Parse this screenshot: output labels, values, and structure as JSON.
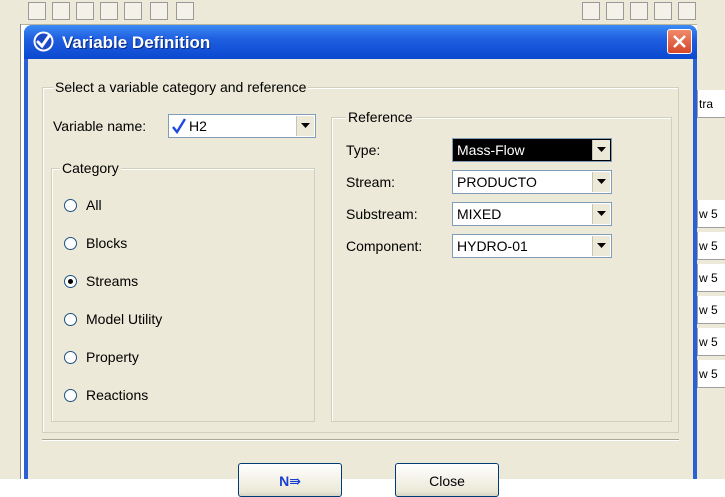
{
  "window": {
    "title": "Variable Definition"
  },
  "section_select": {
    "legend": "Select a variable category and reference"
  },
  "variable": {
    "label": "Variable name:",
    "value": "H2"
  },
  "category": {
    "legend": "Category",
    "options": [
      "All",
      "Blocks",
      "Streams",
      "Model Utility",
      "Property",
      "Reactions"
    ],
    "selected": "Streams"
  },
  "reference": {
    "legend": "Reference",
    "fields": [
      {
        "label": "Type:",
        "value": "Mass-Flow"
      },
      {
        "label": "Stream:",
        "value": "PRODUCTO"
      },
      {
        "label": "Substream:",
        "value": "MIXED"
      },
      {
        "label": "Component:",
        "value": "HYDRO-01"
      }
    ]
  },
  "buttons": {
    "next": "N⇛",
    "close": "Close"
  },
  "background": {
    "right_header": "tra",
    "right_rows": [
      "w 5",
      "w 5",
      "w 5",
      "w 5",
      "w 5",
      "w 5"
    ]
  },
  "colors": {
    "title_bar": "#0b48d0",
    "dialog_face": "#ece9d8",
    "selected_field": "#000000",
    "close_button": "#d6452a"
  }
}
